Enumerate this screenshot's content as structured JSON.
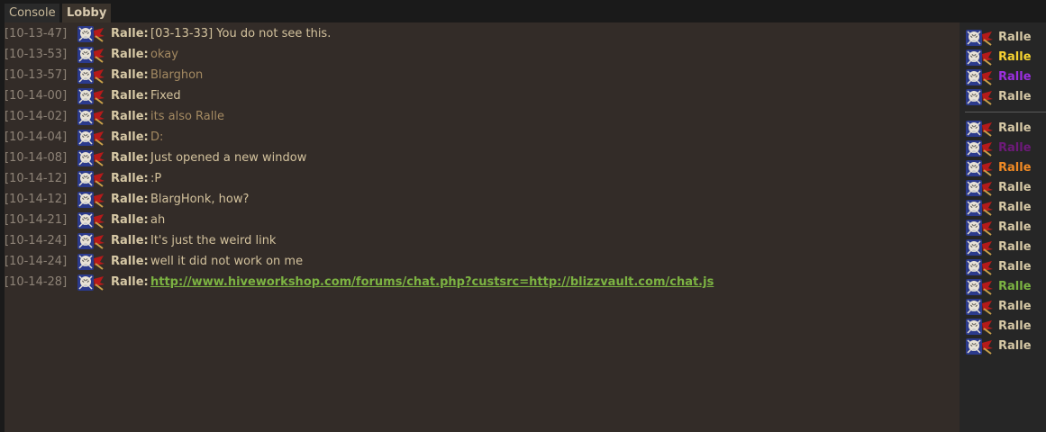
{
  "tabs": [
    {
      "label": "Console"
    },
    {
      "label": "Lobby"
    }
  ],
  "messages": [
    {
      "time": "[10-13-47]",
      "name": "Ralle:",
      "text": "[03-13-33] You do not see this.",
      "color": "#d3c29d"
    },
    {
      "time": "[10-13-53]",
      "name": "Ralle:",
      "text": "okay",
      "color": "#a48a62"
    },
    {
      "time": "[10-13-57]",
      "name": "Ralle:",
      "text": "Blarghon",
      "color": "#a48a62"
    },
    {
      "time": "[10-14-00]",
      "name": "Ralle:",
      "text": "Fixed",
      "color": "#d3c29d"
    },
    {
      "time": "[10-14-02]",
      "name": "Ralle:",
      "text": "its also Ralle",
      "color": "#a48a62"
    },
    {
      "time": "[10-14-04]",
      "name": "Ralle:",
      "text": "D:",
      "color": "#a48a62"
    },
    {
      "time": "[10-14-08]",
      "name": "Ralle:",
      "text": "Just opened a new window",
      "color": "#d3c29d"
    },
    {
      "time": "[10-14-12]",
      "name": "Ralle:",
      "text": ":P",
      "color": "#d3c29d"
    },
    {
      "time": "[10-14-12]",
      "name": "Ralle:",
      "text": "BlargHonk, how?",
      "color": "#d3c29d"
    },
    {
      "time": "[10-14-21]",
      "name": "Ralle:",
      "text": "ah",
      "color": "#d3c29d"
    },
    {
      "time": "[10-14-24]",
      "name": "Ralle:",
      "text": "It's just the weird link",
      "color": "#d3c29d"
    },
    {
      "time": "[10-14-24]",
      "name": "Ralle:",
      "text": "well it did not work on me",
      "color": "#d3c29d"
    },
    {
      "time": "[10-14-28]",
      "name": "Ralle:",
      "text": "http://www.hiveworkshop.com/forums/chat.php?custsrc=http://blizzvault.com/chat.js",
      "color": "#7cb342",
      "link": true
    }
  ],
  "users_top": [
    {
      "name": "Ralle",
      "color": "#d6c8a5"
    },
    {
      "name": "Ralle",
      "color": "#f5d330"
    },
    {
      "name": "Ralle",
      "color": "#9b2fe0"
    },
    {
      "name": "Ralle",
      "color": "#d6c8a5"
    }
  ],
  "users_bottom": [
    {
      "name": "Ralle",
      "color": "#d6c8a5"
    },
    {
      "name": "Ralle",
      "color": "#6e1a7a"
    },
    {
      "name": "Ralle",
      "color": "#f08a24"
    },
    {
      "name": "Ralle",
      "color": "#d6c8a5"
    },
    {
      "name": "Ralle",
      "color": "#d6c8a5"
    },
    {
      "name": "Ralle",
      "color": "#d6c8a5"
    },
    {
      "name": "Ralle",
      "color": "#d6c8a5"
    },
    {
      "name": "Ralle",
      "color": "#d6c8a5"
    },
    {
      "name": "Ralle",
      "color": "#7cb342"
    },
    {
      "name": "Ralle",
      "color": "#d6c8a5"
    },
    {
      "name": "Ralle",
      "color": "#d6c8a5"
    },
    {
      "name": "Ralle",
      "color": "#d6c8a5"
    }
  ],
  "avatar_icon": "skull-crossbones-avatar-icon"
}
